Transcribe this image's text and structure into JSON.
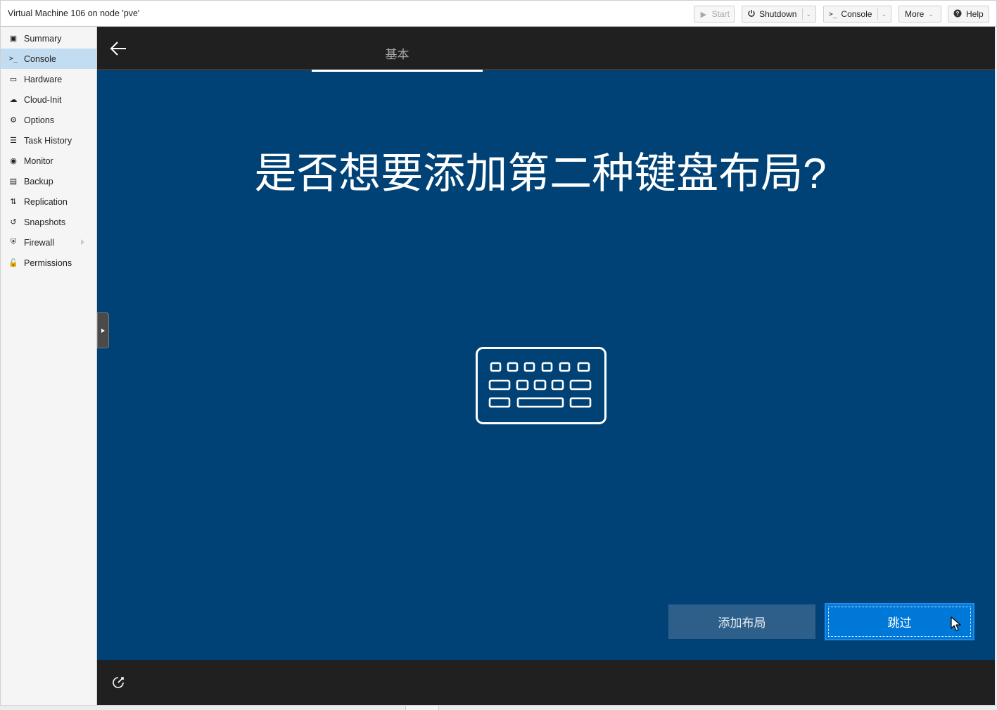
{
  "window": {
    "title": "Virtual Machine 106 on node 'pve'"
  },
  "toolbar": {
    "start_label": "Start",
    "shutdown_label": "Shutdown",
    "console_label": "Console",
    "more_label": "More",
    "help_label": "Help"
  },
  "sidebar": {
    "items": [
      {
        "label": "Summary",
        "icon": "book-icon"
      },
      {
        "label": "Console",
        "icon": "terminal-icon"
      },
      {
        "label": "Hardware",
        "icon": "monitor-icon"
      },
      {
        "label": "Cloud-Init",
        "icon": "cloud-icon"
      },
      {
        "label": "Options",
        "icon": "gear-icon"
      },
      {
        "label": "Task History",
        "icon": "list-icon"
      },
      {
        "label": "Monitor",
        "icon": "eye-icon"
      },
      {
        "label": "Backup",
        "icon": "floppy-icon"
      },
      {
        "label": "Replication",
        "icon": "retweet-icon"
      },
      {
        "label": "Snapshots",
        "icon": "history-icon"
      },
      {
        "label": "Firewall",
        "icon": "shield-icon"
      },
      {
        "label": "Permissions",
        "icon": "unlock-icon"
      }
    ],
    "active_index": 1
  },
  "console": {
    "tab_label": "基本",
    "question": "是否想要添加第二种键盘布局?",
    "add_layout_label": "添加布局",
    "skip_label": "跳过"
  },
  "colors": {
    "oobe_background": "#004275",
    "header_background": "#202020",
    "skip_button": "#0078d7",
    "add_button": "#2d5f8a",
    "sidebar_active": "#c2ddf2"
  }
}
